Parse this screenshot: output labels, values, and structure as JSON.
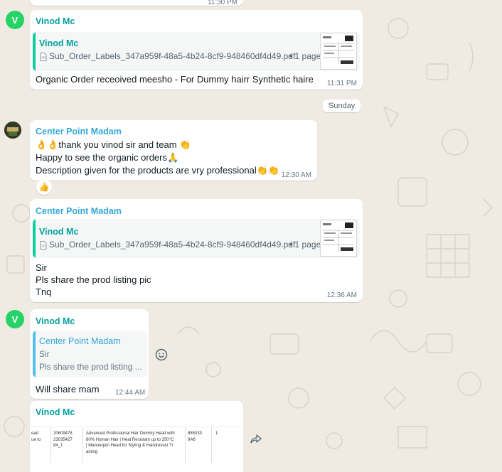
{
  "colors": {
    "background": "#efeae2",
    "bubble": "#ffffff",
    "vinod_name": "#06a0a0",
    "madam_name": "#35a8d8",
    "quote_bar_vinod": "#06cf9c",
    "quote_bar_madam": "#53bdeb",
    "avatar_green": "#25d366",
    "time_gray": "#667781"
  },
  "top_partial_time": "11:30 PM",
  "msg1": {
    "avatar_letter": "V",
    "sender": "Vinod Mc",
    "quote_sender": "Vinod Mc",
    "doc_icon": "document-icon",
    "doc_name": "Sub_Order_Labels_347a959f-48a5-4b24-8cf9-948460df4d49.pdf",
    "doc_meta": "• 1 page",
    "text": "Organic Order receoived meesho - For Dummy hairr Synthetic haire",
    "time": "11:31 PM"
  },
  "day_separator": "Sunday",
  "msg2": {
    "sender": "Center Point Madam",
    "line1": "👌👌thank you vinod sir and team 👏",
    "line2": "Happy to see the organic orders🙏",
    "line3": "Description given for the products are vry professional👏👏",
    "time": "12:30 AM",
    "reaction": "👍"
  },
  "msg3": {
    "sender": "Center Point Madam",
    "quote_sender": "Vinod Mc",
    "doc_name": "Sub_Order_Labels_347a959f-48a5-4b24-8cf9-948460df4d49.pdf",
    "doc_meta": "• 1 page",
    "line1": "Sir",
    "line2": "Pls share the prod listing pic",
    "line3": "Tnq",
    "time": "12:36 AM"
  },
  "msg4": {
    "avatar_letter": "V",
    "sender": "Vinod Mc",
    "quote_sender": "Center Point Madam",
    "quote_line1": "Sir",
    "quote_line2": "Pls share the prod listing ...",
    "text": "Will share mam",
    "time": "12:44 AM",
    "emoji_icon": "smiley-icon"
  },
  "msg5": {
    "sender": "Vinod Mc",
    "table_col1": [
      "ead",
      "ue to"
    ],
    "table_col2": [
      "20609478",
      "23035427",
      "84_1"
    ],
    "table_col3": [
      "Advanced Professional Hair Dummy Head with",
      "80% Human Hair | Heat Resistant up to 250°C",
      "| Mannequin Head for Styling & Hairdresser Tr",
      "aining"
    ],
    "table_col4": [
      "885033",
      "9A6"
    ],
    "table_col5": "1",
    "forward_icon": "forward-icon"
  }
}
